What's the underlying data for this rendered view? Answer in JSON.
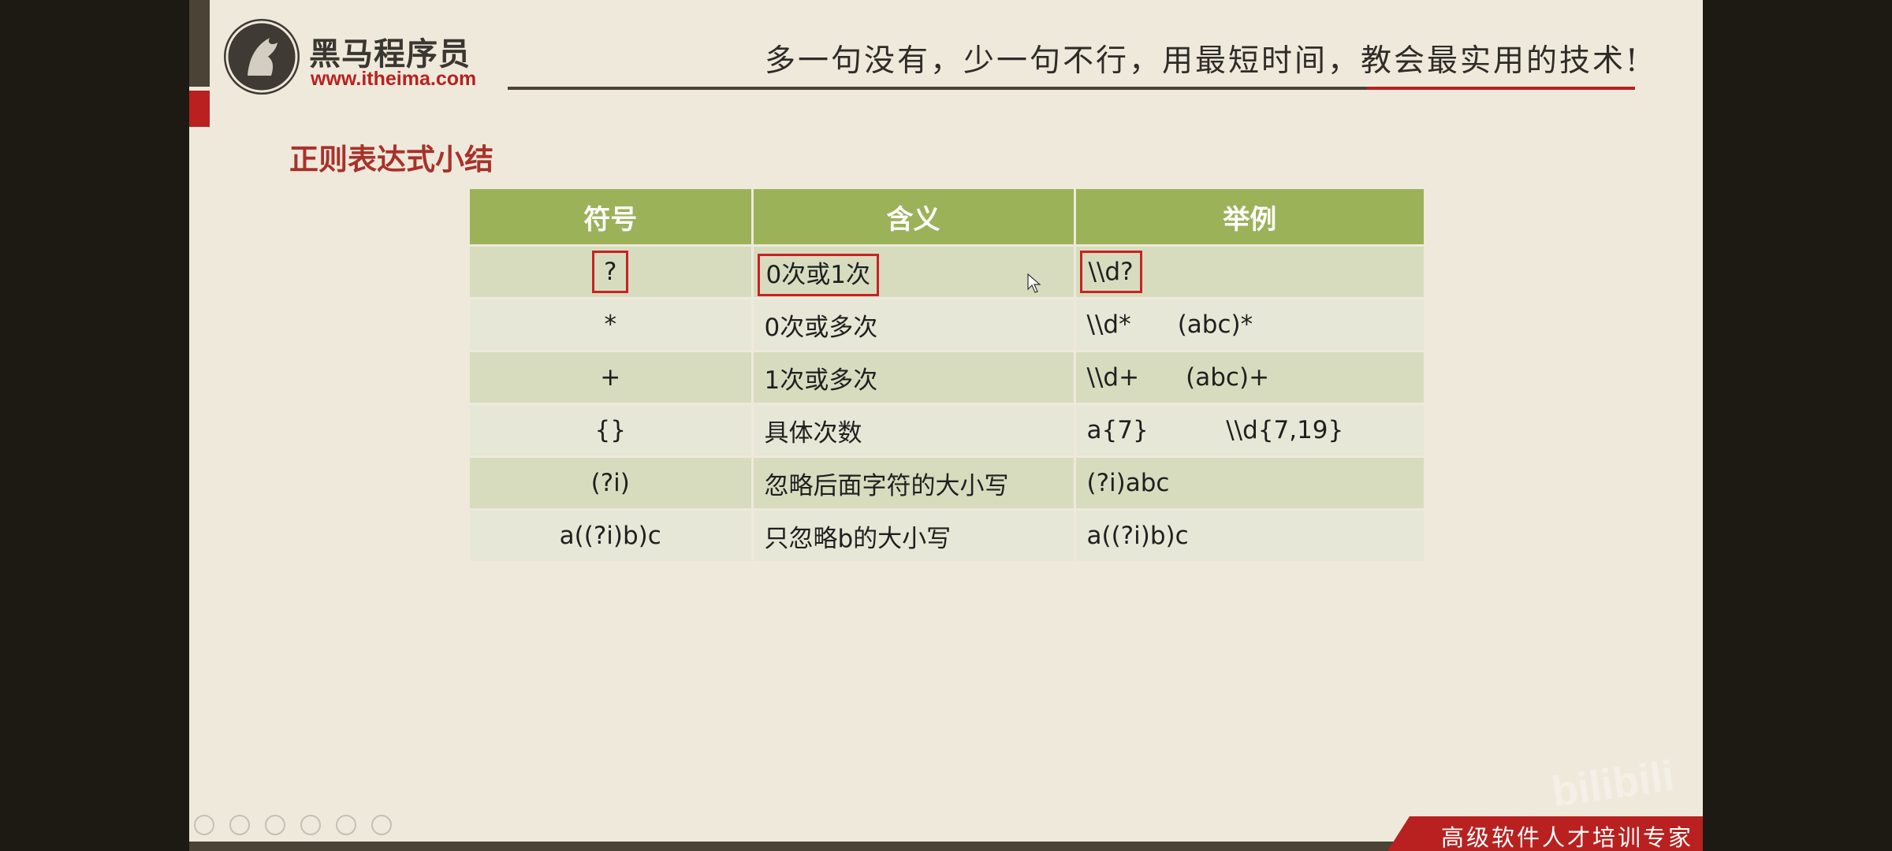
{
  "brand": {
    "name": "黑马程序员",
    "url": "www.itheima.com"
  },
  "slogan": "多一句没有，少一句不行，用最短时间，教会最实用的技术!",
  "section_title": "正则表达式小结",
  "table": {
    "headers": [
      "符号",
      "含义",
      "举例"
    ],
    "rows": [
      {
        "symbol": "?",
        "meaning": "0次或1次",
        "example": "\\\\d?",
        "highlighted": true
      },
      {
        "symbol": "*",
        "meaning": "0次或多次",
        "example": "\\\\d*      (abc)*",
        "highlighted": false
      },
      {
        "symbol": "+",
        "meaning": "1次或多次",
        "example": "\\\\d+      (abc)+",
        "highlighted": false
      },
      {
        "symbol": "{}",
        "meaning": "具体次数",
        "example": "a{7}          \\\\d{7,19}",
        "highlighted": false
      },
      {
        "symbol": "(?i)",
        "meaning": "忽略后面字符的大小写",
        "example": "(?i)abc",
        "highlighted": false
      },
      {
        "symbol": "a((?i)b)c",
        "meaning": "只忽略b的大小写",
        "example": "a((?i)b)c",
        "highlighted": false
      }
    ]
  },
  "footer_tag": "高级软件人才培训专家",
  "watermark": "bilibili",
  "colors": {
    "accent_red": "#b8211f",
    "header_green": "#9bb259",
    "title_red": "#a8322a",
    "highlight_box": "#c82222"
  }
}
